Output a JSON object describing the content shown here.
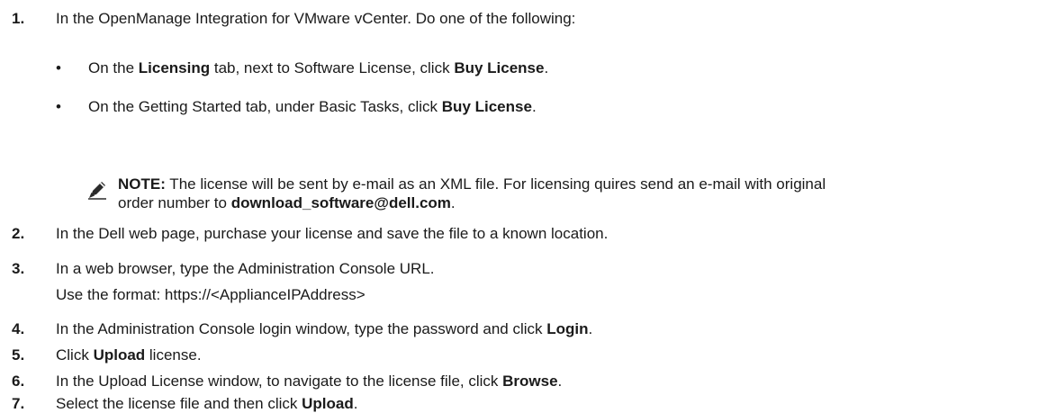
{
  "steps": [
    {
      "num": "1.",
      "text": "In the OpenManage Integration for VMware vCenter. Do one of the following:"
    },
    {
      "num": "2.",
      "text": "In the Dell web page, purchase your license and save the file to a known location."
    },
    {
      "num": "3.",
      "text": "In a web browser, type the Administration Console URL.",
      "sub": "Use the format: https://<ApplianceIPAddress>"
    },
    {
      "num": "4.",
      "pre": "In the Administration Console login window, type the password and click ",
      "bold": "Login",
      "post": "."
    },
    {
      "num": "5.",
      "pre": "Click ",
      "bold": "Upload",
      "post": " license."
    },
    {
      "num": "6.",
      "pre": "In the Upload License window, to navigate to the license file, click ",
      "bold": "Browse",
      "post": "."
    },
    {
      "num": "7.",
      "pre": "Select the license file and then click ",
      "bold": "Upload",
      "post": "."
    }
  ],
  "bullets": [
    {
      "glyph": "•",
      "pre": "On the ",
      "bold1": "Licensing",
      "mid": " tab, next to Software License, click ",
      "bold2": "Buy License",
      "post": "."
    },
    {
      "glyph": "•",
      "pre": "On the Getting Started tab, under Basic Tasks, click ",
      "bold2": "Buy License",
      "post": "."
    }
  ],
  "note": {
    "icon": "pencil-icon",
    "label": "NOTE:",
    "line1": " The license will be sent by e-mail as an XML file. For licensing quires send an e-mail with original",
    "line2_pre": "order number to ",
    "email": "download_software@dell.com",
    "line2_post": "."
  }
}
